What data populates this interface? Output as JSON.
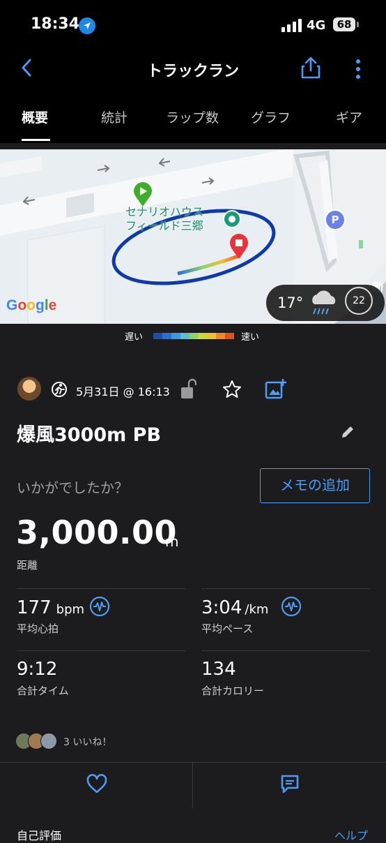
{
  "status_bar": {
    "time": "18:34",
    "network": "4G",
    "battery": "68"
  },
  "header": {
    "title": "トラックラン"
  },
  "tabs": [
    {
      "label": "概要",
      "active": true
    },
    {
      "label": "統計"
    },
    {
      "label": "ラップ数"
    },
    {
      "label": "グラフ"
    },
    {
      "label": "ギア"
    }
  ],
  "map": {
    "place_name_line1": "セナリオハウス",
    "place_name_line2": "フィールド三郷",
    "provider": "Google",
    "parking_label": "P",
    "road_label": "動"
  },
  "weather": {
    "temperature": "17°",
    "wind": "22",
    "icon": "rain-cloud-icon"
  },
  "pace_legend": {
    "slow_label": "遅い",
    "fast_label": "速い",
    "colors": [
      "#1f4fa8",
      "#2a6fd1",
      "#3a9be0",
      "#5bbfd3",
      "#8bd36b",
      "#c8d83a",
      "#f0c030",
      "#f08a25",
      "#e84f1e"
    ]
  },
  "activity": {
    "date": "5月31日 @ 16:13",
    "title": "爆風3000m PB",
    "prompt": "いかがでしたか？",
    "memo_button": "メモの追加"
  },
  "distance": {
    "value": "3,000.00",
    "unit": "m",
    "label": "距離"
  },
  "stats": {
    "avg_hr": {
      "value": "177",
      "unit": "bpm",
      "label": "平均心拍"
    },
    "avg_pace": {
      "value": "3:04",
      "unit": "/km",
      "label": "平均ペース"
    },
    "total_time": {
      "value": "9:12",
      "label": "合計タイム"
    },
    "calories": {
      "value": "134",
      "label": "合計カロリー"
    }
  },
  "likes": {
    "text": "3 いいね！"
  },
  "footer": {
    "self_eval": "自己評価",
    "help": "ヘルプ"
  },
  "colors": {
    "accent": "#4b9cf2",
    "background": "#1c1c1e",
    "route": "#0d3aa8"
  }
}
